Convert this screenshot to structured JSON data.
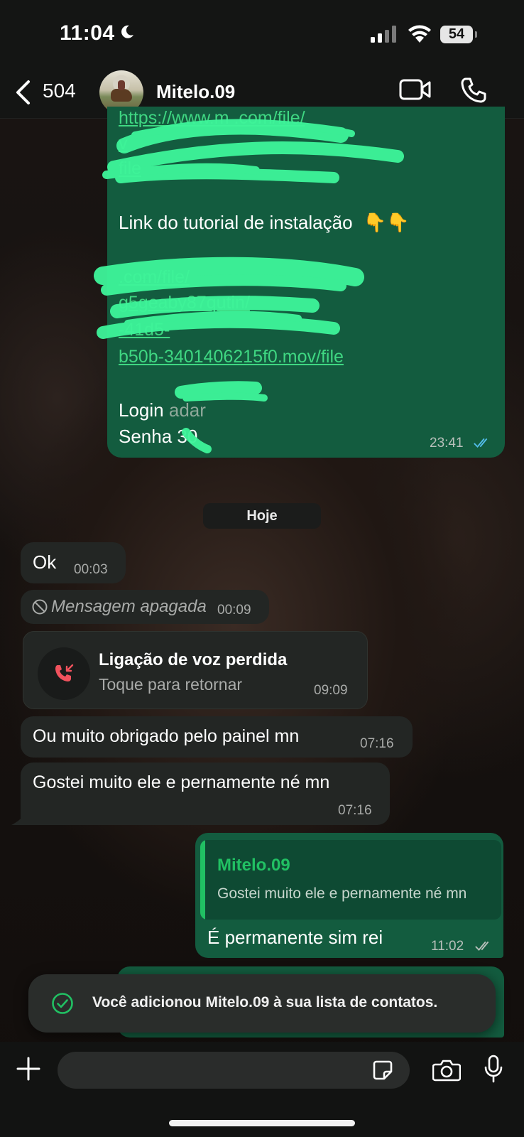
{
  "status_bar": {
    "time": "11:04",
    "battery": "54"
  },
  "header": {
    "back_count": "504",
    "contact_name": "Mitelo.09"
  },
  "messages": {
    "tutorial_label": "Link do tutorial de instalação",
    "tutorial_emoji": "👇👇",
    "link_fragment_1": "https://www.m          .com/file/",
    "link_fragment_2": "v          ",
    "link_fragment_3": "                         file",
    "link_fragment_4": "                          .com/file/",
    "link_fragment_5": "g5geaby87qutin/",
    "link_fragment_6": "               -41d5-",
    "link_fragment_7": "b50b-3401406215f0.mov/file",
    "login_label": "Login",
    "login_value": "adar",
    "senha_label": "Senha",
    "senha_value": "30",
    "sent_time_1": "23:41",
    "date_chip": "Hoje",
    "ok_text": "Ok",
    "ok_time": "00:03",
    "deleted_text": "Mensagem apagada",
    "deleted_time": "00:09",
    "call_title": "Ligação de voz perdida",
    "call_subtitle": "Toque para retornar",
    "call_time": "09:09",
    "thanks_text": "Ou muito obrigado pelo painel mn",
    "thanks_time": "07:16",
    "gostei_text": "Gostei muito ele e pernamente né mn",
    "gostei_time": "07:16",
    "reply_quote_name": "Mitelo.09",
    "reply_quote_text": "Gostei muito ele e pernamente né mn",
    "reply_text": "É permanente sim rei",
    "reply_time": "11:02"
  },
  "toast": {
    "text": "Você adicionou Mitelo.09 à sua lista de contatos."
  },
  "colors": {
    "accent_green": "#21c063",
    "outgoing_bubble": "#135c3f",
    "incoming_bubble": "#232624",
    "scribble": "#3ef59a",
    "missed_call_red": "#f0525d",
    "read_tick": "#53bdeb"
  }
}
